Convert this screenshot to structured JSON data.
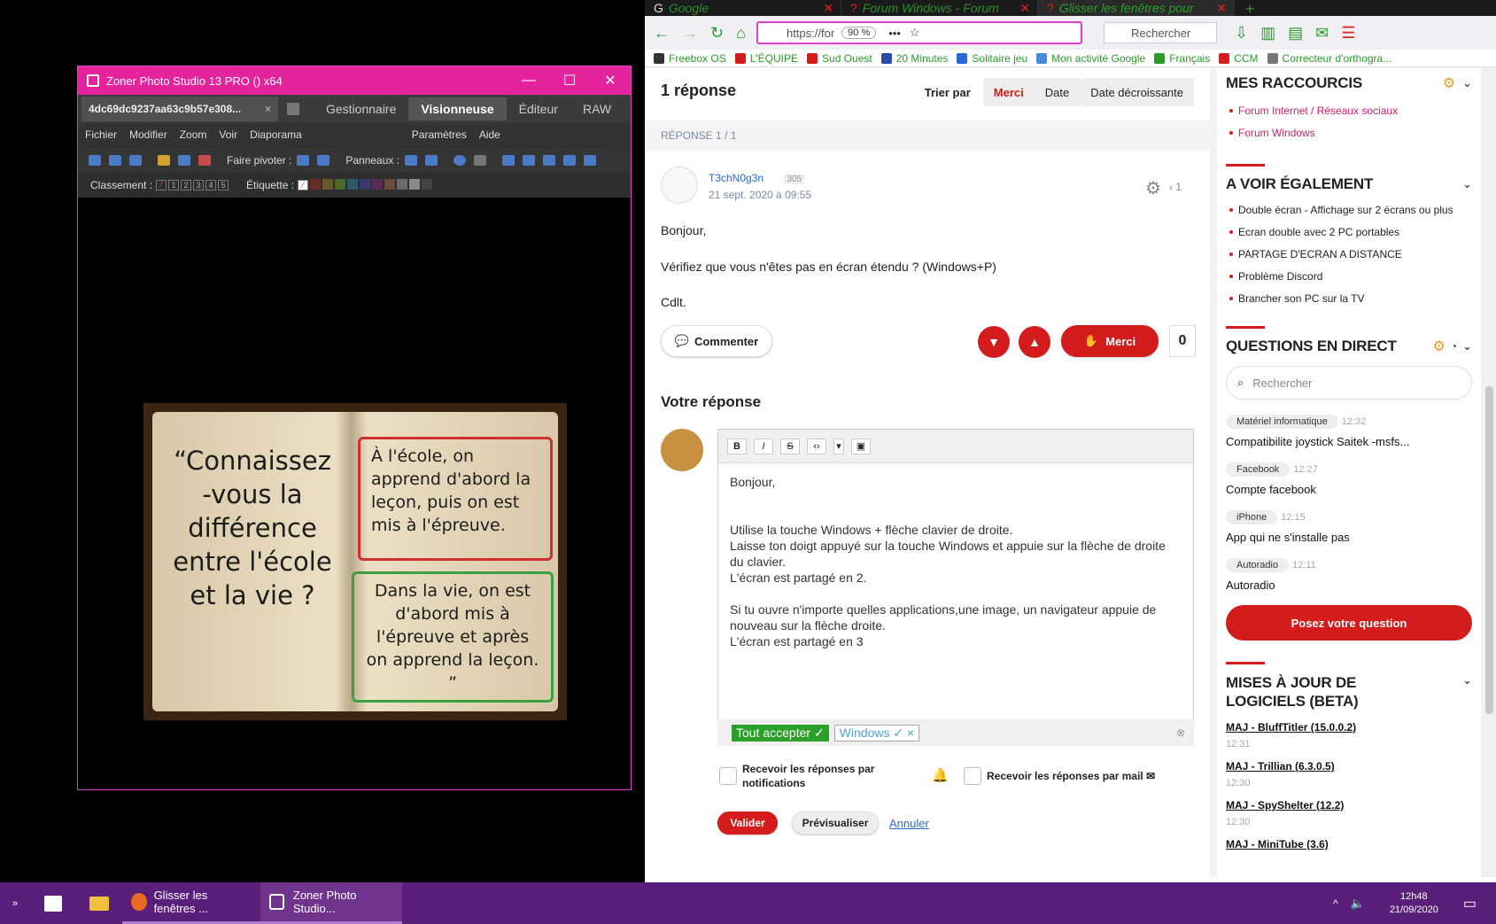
{
  "zoner": {
    "title": "Zoner Photo Studio 13 PRO  () x64",
    "doc_tab": "4dc69dc9237aa63c9b57e308...",
    "modes": [
      "Gestionnaire",
      "Visionneuse",
      "Éditeur",
      "RAW"
    ],
    "menu": [
      "Fichier",
      "Modifier",
      "Zoom",
      "Voir",
      "Diaporama",
      "Paramètres",
      "Aide"
    ],
    "rotate_label": "Faire pivoter :",
    "panels_label": "Panneaux :",
    "rating_label": "Classement :",
    "rating_values": [
      "1",
      "2",
      "3",
      "4",
      "5"
    ],
    "tag_label": "Étiquette :",
    "tag_colors": [
      "#6a2a2a",
      "#6a5a2a",
      "#4a6a2a",
      "#2a5a6a",
      "#3a3a6a",
      "#5a2a5a",
      "#6a4a3a",
      "#6a6a6a",
      "#888888",
      "#444444"
    ],
    "image": {
      "left_text": "“Connaissez -vous la différence entre l'école et la vie ?",
      "red_text": "À l'école, on apprend d'abord la leçon, puis on est mis à l'épreuve.",
      "green_text": "Dans la vie, on est d'abord mis à l'épreuve et après on apprend la leçon. ”"
    }
  },
  "browser": {
    "tabs": [
      {
        "label": "Google",
        "active": false
      },
      {
        "label": "Forum Windows - Forum",
        "active": false
      },
      {
        "label": "Glisser les fenêtres pour",
        "active": true
      }
    ],
    "url": "https://for",
    "zoom": "90 %",
    "search_placeholder": "Rechercher",
    "bookmarks": [
      {
        "label": "Freebox OS",
        "color": "#333333"
      },
      {
        "label": "L'ÉQUIPE",
        "color": "#d51c1c"
      },
      {
        "label": "Sud Ouest",
        "color": "#d51c1c"
      },
      {
        "label": "20 Minutes",
        "color": "#2a4aa8"
      },
      {
        "label": "Solitaire jeu",
        "color": "#2a6ad8"
      },
      {
        "label": "Mon activité Google",
        "color": "#4a8ad8"
      },
      {
        "label": "Français",
        "color": "#2a9a2a"
      },
      {
        "label": "CCM",
        "color": "#d51c1c"
      },
      {
        "label": "Correcteur d'orthogra...",
        "color": "#777777"
      }
    ]
  },
  "thread": {
    "count_label": "1 réponse",
    "sort_label": "Trier par",
    "sort_options": [
      "Merci",
      "Date",
      "Date décroissante"
    ],
    "response_index": "RÉPONSE 1 / 1",
    "author": "T3chN0g3n",
    "author_points": "305",
    "date": "21 sept. 2020 à 09:55",
    "reply_count": "1",
    "body": [
      "Bonjour,",
      "Vérifiez que vous n'êtes pas en écran étendu ? (Windows+P)",
      "Cdlt."
    ],
    "comment_label": "Commenter",
    "merci_label": "Merci",
    "merci_count": "0",
    "your_reply_title": "Votre réponse",
    "editor_buttons": [
      "B",
      "I",
      "S",
      "‹›",
      "▾",
      "▣"
    ],
    "editor_text": "Bonjour,\n\n\nUtilise la touche Windows + flèche clavier de droite.\nLaisse ton doigt appuyé sur la touche Windows et appuie sur la flèche de droite du clavier.\nL'écran est partagé en 2.\n\nSi tu ouvre n'importe quelles applications,une image, un navigateur appuie de nouveau sur la flèche droite.\nL'écran est partagé en 3",
    "tag_accept": "Tout accepter ✓",
    "tag_windows": "Windows ✓ ×",
    "notif_label": "Recevoir les réponses par notifications",
    "mail_label": "Recevoir les réponses par mail",
    "submit_label": "Valider",
    "preview_label": "Prévisualiser",
    "cancel_label": "Annuler"
  },
  "sidebar": {
    "shortcuts_title": "MES RACCOURCIS",
    "shortcuts": [
      "Forum Internet / Réseaux sociaux",
      "Forum Windows"
    ],
    "see_also_title": "A VOIR ÉGALEMENT",
    "see_also": [
      "Double écran - Affichage sur 2 écrans ou plus",
      "Ecran double avec 2 PC portables",
      "PARTAGE D'ECRAN A DISTANCE",
      "Problème Discord",
      "Brancher son PC sur la TV"
    ],
    "live_title": "QUESTIONS EN DIRECT",
    "live_search_placeholder": "Rechercher",
    "questions": [
      {
        "cat": "Matériel informatique",
        "time": "12:32",
        "title": "Compatibilite joystick Saitek -msfs..."
      },
      {
        "cat": "Facebook",
        "time": "12:27",
        "title": "Compte facebook"
      },
      {
        "cat": "iPhone",
        "time": "12:15",
        "title": "App qui ne s'installe pas"
      },
      {
        "cat": "Autoradio",
        "time": "12:11",
        "title": "Autoradio"
      }
    ],
    "ask_button": "Posez votre question",
    "updates_title": "MISES À JOUR DE LOGICIELS (BETA)",
    "updates": [
      {
        "title": "MAJ - BluffTitler (15.0.0.2)",
        "time": "12:31"
      },
      {
        "title": "MAJ - Trillian (6.3.0.5)",
        "time": "12:30"
      },
      {
        "title": "MAJ - SpyShelter (12.2)",
        "time": "12:30"
      },
      {
        "title": "MAJ - MiniTube (3.6)",
        "time": ""
      }
    ]
  },
  "taskbar": {
    "apps": [
      {
        "label": "Glisser les fenêtres ...",
        "active": false
      },
      {
        "label": "Zoner Photo Studio...",
        "active": true
      }
    ],
    "time": "12h48",
    "date": "21/09/2020"
  }
}
